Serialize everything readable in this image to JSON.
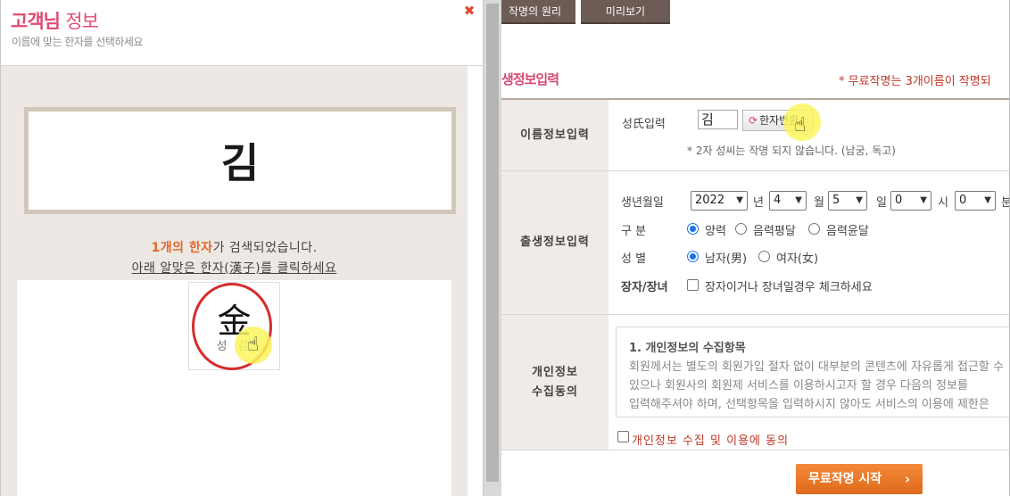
{
  "popup": {
    "title_bold": "고객님",
    "title_rest": "정보",
    "subtitle": "이름에 맞는 한자를 선택하세요",
    "close_icon": "✖",
    "surname_display": "김",
    "result_count": "1개의 한자",
    "result_suffix": "가 검색되었습니다.",
    "click_instruction": "아래 알맞은 한자(漢子)를 클릭하세요",
    "hanja_options": [
      {
        "char": "金",
        "reading": "성 김"
      }
    ]
  },
  "form": {
    "tabs": [
      "작명의 원리",
      "미리보기"
    ],
    "section_title": "생정보입력",
    "notice": "* 무료작명는 3개이름이 작명되",
    "rows": {
      "name_info": {
        "label": "이름정보입력",
        "surname_label": "성氏입력",
        "surname_value": "김",
        "hanja_button": "한자변환",
        "hanja_button_icon": "⟳",
        "hint": "* 2자 성씨는 작명 되지 않습니다. (남궁, 독고)"
      },
      "birth_info": {
        "label": "출생정보입력",
        "birth_label": "생년월일",
        "year": "2022",
        "year_unit": "년",
        "month": "4",
        "month_unit": "월",
        "day": "5",
        "day_unit": "일",
        "hour": "0",
        "hour_unit": "시",
        "minute": "0",
        "minute_unit": "분",
        "calendar_label": "구 분",
        "calendar_options": [
          "양력",
          "음력평달",
          "음력윤달"
        ],
        "calendar_selected": "양력",
        "gender_label": "성 별",
        "gender_options": [
          "남자(男)",
          "여자(女)"
        ],
        "gender_selected": "남자(男)",
        "eldest_label": "장자/장녀",
        "eldest_text": "장자이거나 장녀일경우 체크하세요"
      },
      "privacy": {
        "label_line1": "개인정보",
        "label_line2": "수집동의",
        "heading": "1. 개인정보의 수집항목",
        "body": "회원께서는 별도의 회원가입 절차 없이 대부분의 콘텐츠에 자유롭게 접근할 수 있으나 회원사의 회원제 서비스를 이용하시고자 할 경우 다음의 정보를 입력해주셔야 하며, 선택항목을 입력하시지 않아도 서비스의 이용에 제한은 없습니다."
      }
    },
    "agree_text": "개인정보 수집 및 이용에 동의",
    "start_button": "무료작명 시작",
    "start_button_icon": "›"
  },
  "icons": {
    "cursor": "hand-pointer-icon",
    "close": "close-icon"
  },
  "colors": {
    "accent_pink": "#e14c73",
    "accent_orange": "#e2692c",
    "tab_brown": "#6d5c55",
    "notice_red": "#c0392b",
    "start_orange": "#f07a2a"
  }
}
